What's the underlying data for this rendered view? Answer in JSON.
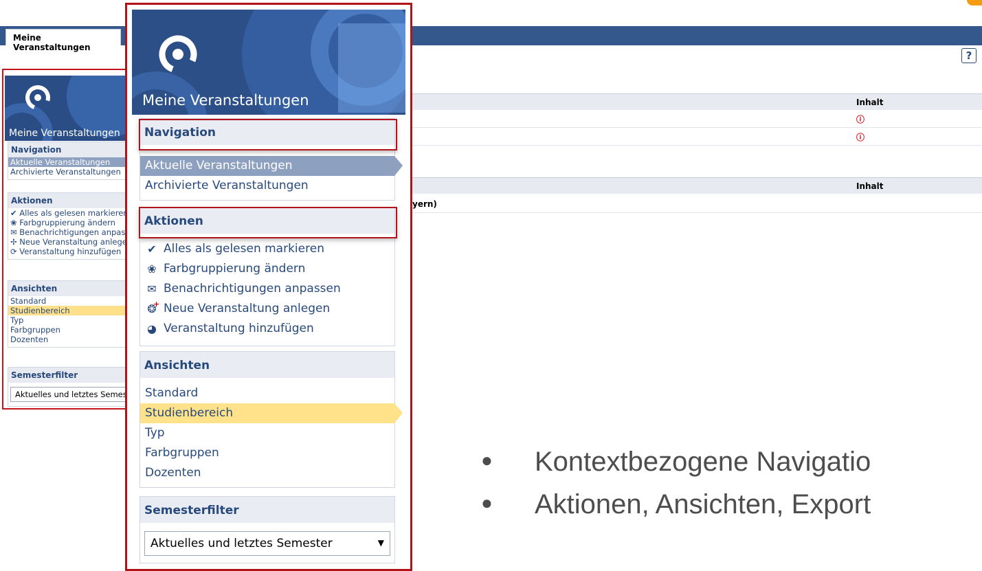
{
  "page": {
    "tab_label": "Meine Veranstaltungen",
    "help_icon": "?",
    "table1": {
      "header": "Inhalt",
      "rows": [
        "ⓘ",
        "ⓘ"
      ]
    },
    "table2": {
      "header": "Inhalt",
      "row_text": "yern)"
    }
  },
  "sidebar": {
    "title": "Meine Veranstaltungen",
    "navigation": {
      "header": "Navigation",
      "items": [
        "Aktuelle Veranstaltungen",
        "Archivierte Veranstaltungen"
      ],
      "selected": "Aktuelle Veranstaltungen"
    },
    "actions": {
      "header": "Aktionen",
      "items": [
        {
          "icon": "checkmark-icon",
          "label": "Alles als gelesen markieren"
        },
        {
          "icon": "palette-icon",
          "label": "Farbgruppierung ändern"
        },
        {
          "icon": "envelope-icon",
          "label": "Benachrichtigungen anpassen"
        },
        {
          "icon": "new-course-icon",
          "label": "Neue Veranstaltung anlegen"
        },
        {
          "icon": "add-course-icon",
          "label": "Veranstaltung hinzufügen"
        }
      ]
    },
    "views": {
      "header": "Ansichten",
      "items": [
        "Standard",
        "Studienbereich",
        "Typ",
        "Farbgruppen",
        "Dozenten"
      ],
      "selected": "Studienbereich"
    },
    "semester_filter": {
      "header": "Semesterfilter",
      "value": "Aktuelles und letztes Semester"
    }
  },
  "small_sidebar": {
    "actions_items": [
      "Alles als gelesen markieren",
      "Farbgruppierung ändern",
      "Benachrichtigungen anpas",
      "Neue Veranstaltung anlege",
      "Veranstaltung hinzufügen"
    ],
    "semester_value": "Aktuelles und letztes Semeste"
  },
  "bullets": [
    "Kontextbezogene Navigatio",
    "Aktionen, Ansichten, Export"
  ],
  "colors": {
    "header_blue": "#34578c",
    "highlight_red": "#b3121b",
    "selection_blue": "#8ea0bf",
    "selection_yellow": "#ffe28a"
  }
}
